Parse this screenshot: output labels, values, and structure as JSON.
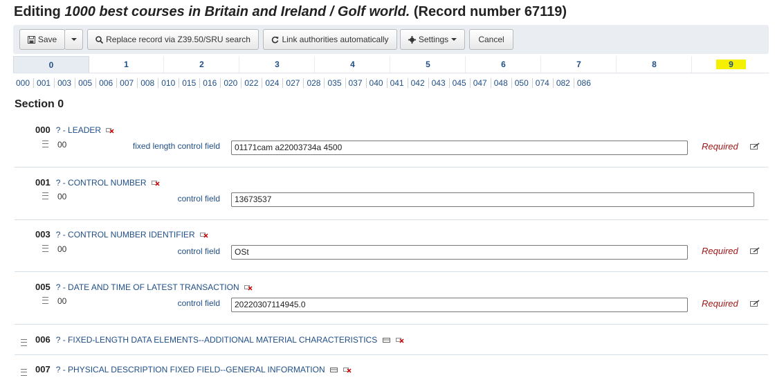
{
  "title": {
    "prefix": "Editing ",
    "record_title": "1000 best courses in Britain and Ireland / Golf world.",
    "suffix": " (Record number 67119)"
  },
  "toolbar": {
    "save": "Save",
    "replace": "Replace record via Z39.50/SRU search",
    "link": "Link authorities automatically",
    "settings": "Settings",
    "cancel": "Cancel"
  },
  "tabs": [
    "0",
    "1",
    "2",
    "3",
    "4",
    "5",
    "6",
    "7",
    "8",
    "9"
  ],
  "active_tab": "0",
  "highlighted_tab": "9",
  "field_nav": [
    "000",
    "001",
    "003",
    "005",
    "006",
    "007",
    "008",
    "010",
    "015",
    "016",
    "020",
    "022",
    "024",
    "027",
    "028",
    "035",
    "037",
    "040",
    "041",
    "042",
    "043",
    "045",
    "047",
    "048",
    "050",
    "074",
    "082",
    "086"
  ],
  "section_title": "Section 0",
  "fields": [
    {
      "tag": "000",
      "link": "? - LEADER",
      "indicator": "00",
      "sublabel": "fixed length control field",
      "value": "01171cam a22003734a 4500",
      "required": "Required"
    },
    {
      "tag": "001",
      "link": "? - CONTROL NUMBER",
      "indicator": "00",
      "sublabel": "control field",
      "value": "13673537",
      "required": ""
    },
    {
      "tag": "003",
      "link": "? - CONTROL NUMBER IDENTIFIER",
      "indicator": "00",
      "sublabel": "control field",
      "value": "OSt",
      "required": "Required"
    },
    {
      "tag": "005",
      "link": "? - DATE AND TIME OF LATEST TRANSACTION",
      "indicator": "00",
      "sublabel": "control field",
      "value": "20220307114945.0",
      "required": "Required"
    },
    {
      "tag": "006",
      "link": "? - FIXED-LENGTH DATA ELEMENTS--ADDITIONAL MATERIAL CHARACTERISTICS"
    },
    {
      "tag": "007",
      "link": "? - PHYSICAL DESCRIPTION FIXED FIELD--GENERAL INFORMATION"
    }
  ],
  "colors": {
    "link": "#1f4e87",
    "required": "#a01818",
    "highlight": "#f4f000",
    "toolbar_bg": "#eaeef2"
  }
}
